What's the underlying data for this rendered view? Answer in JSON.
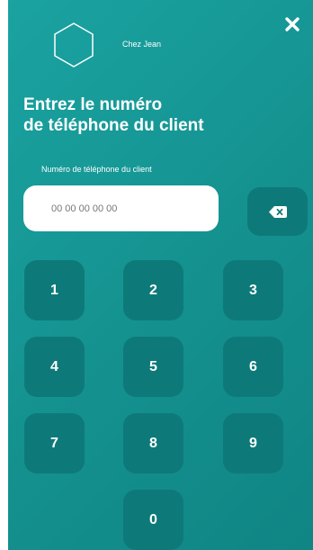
{
  "header": {
    "brand_name": "Chez Jean",
    "logo_icon": "hexagon-icon",
    "close_icon": "close-icon"
  },
  "main": {
    "title_line1": "Entrez le numéro",
    "title_line2": "de téléphone du client",
    "phone_field": {
      "label": "Numéro de téléphone du client",
      "value": "",
      "placeholder": "00 00 00 00 00"
    },
    "backspace_icon": "backspace-icon"
  },
  "keypad": {
    "keys": [
      "1",
      "2",
      "3",
      "4",
      "5",
      "6",
      "7",
      "8",
      "9",
      "0"
    ]
  },
  "colors": {
    "background": "#14918f",
    "key_background": "#0d7a79",
    "text": "#ffffff"
  }
}
